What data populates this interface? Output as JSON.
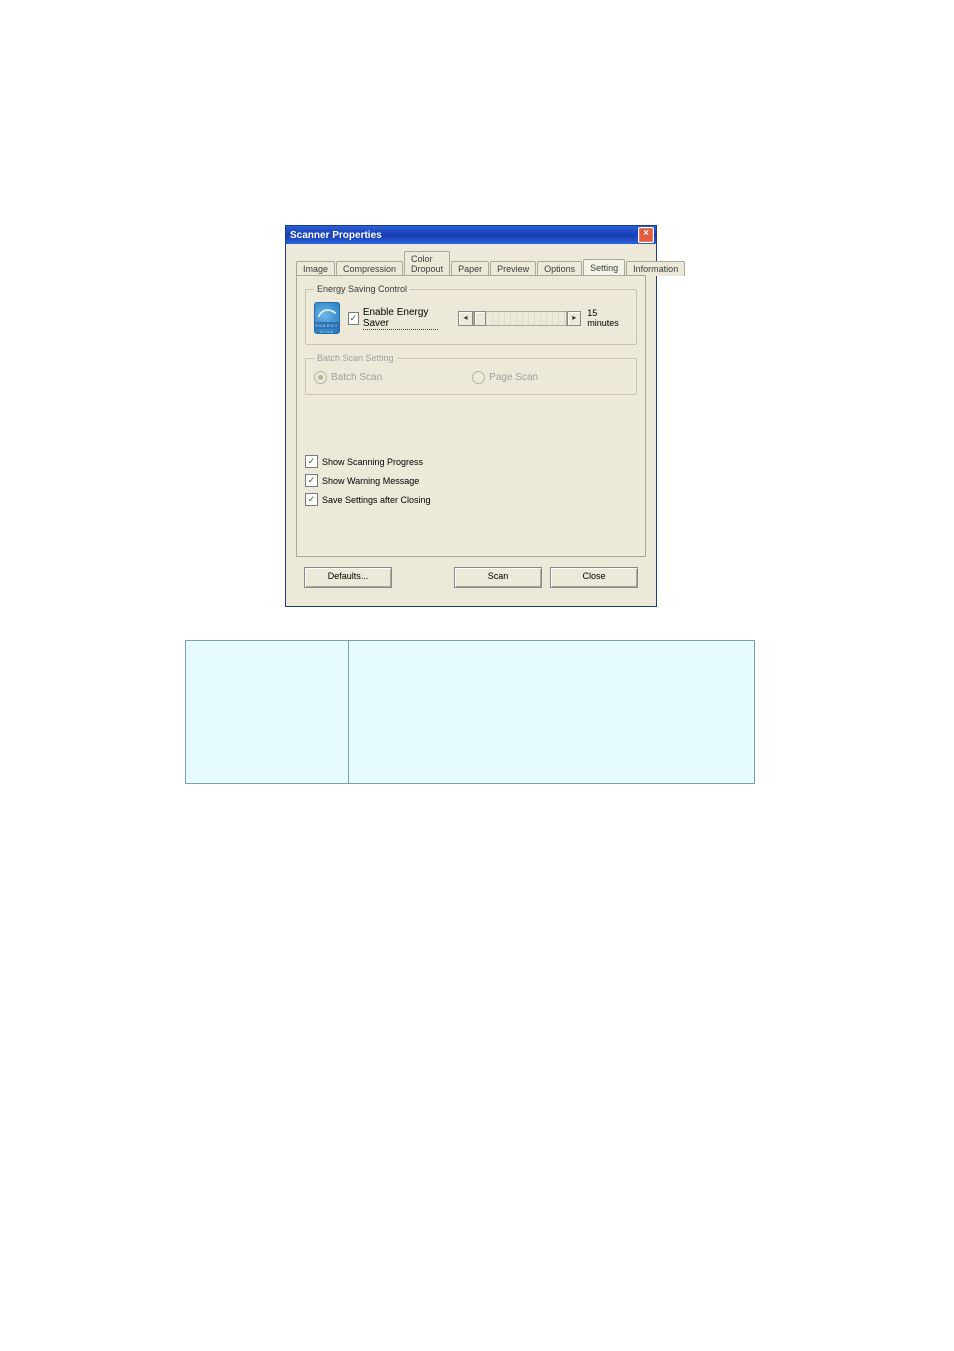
{
  "dialog": {
    "title": "Scanner Properties",
    "close_glyph": "×",
    "tabs": {
      "image": "Image",
      "compression": "Compression",
      "color_dropout": "Color Dropout",
      "paper": "Paper",
      "preview": "Preview",
      "options": "Options",
      "setting": "Setting",
      "information": "Information"
    },
    "energy_saving": {
      "legend": "Energy Saving Control",
      "enable_label": "Enable Energy Saver",
      "logo_text": "ENERGY STAR",
      "slider_value": "15 minutes"
    },
    "batch_scan": {
      "legend": "Batch Scan Setting",
      "batch_label": "Batch Scan",
      "page_label": "Page Scan"
    },
    "checks": {
      "show_progress": "Show Scanning Progress",
      "show_warning": "Show Warning Message",
      "save_settings": "Save Settings after Closing"
    },
    "buttons": {
      "defaults": "Defaults...",
      "scan": "Scan",
      "close": "Close"
    }
  },
  "table": {
    "cell_1": "",
    "cell_2": ""
  }
}
